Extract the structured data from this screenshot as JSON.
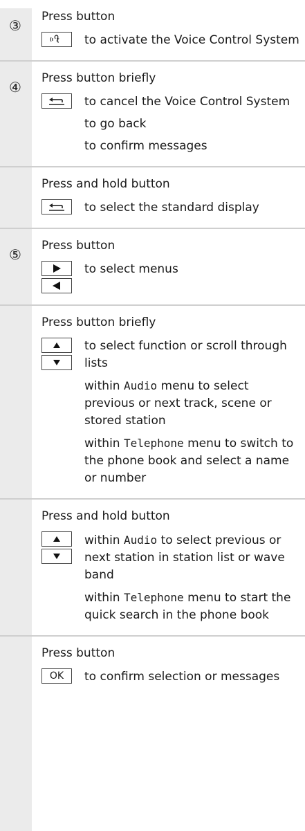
{
  "sections": [
    {
      "number": "③",
      "heading": "Press button",
      "entries": [
        {
          "keys": [
            "voice-icon"
          ],
          "lines": [
            "to activate the Voice Control System"
          ]
        }
      ]
    },
    {
      "number": "④",
      "heading": "Press button briefly",
      "entries": [
        {
          "keys": [
            "back-icon"
          ],
          "lines": [
            "to cancel the Voice Control System",
            "to go back",
            "to confirm messages"
          ]
        }
      ]
    },
    {
      "number": "",
      "heading": "Press and hold button",
      "entries": [
        {
          "keys": [
            "back-icon"
          ],
          "lines": [
            "to select the standard display"
          ]
        }
      ]
    },
    {
      "number": "⑤",
      "heading": "Press button",
      "entries": [
        {
          "keys": [
            "right-arrow-icon",
            "left-arrow-icon"
          ],
          "lines": [
            "to select menus"
          ]
        }
      ]
    },
    {
      "number": "",
      "heading": "Press button briefly",
      "entries": [
        {
          "keys": [
            "up-arrow-icon",
            "down-arrow-icon"
          ],
          "lines": [
            "to select function or scroll through lists",
            {
              "pre": "within ",
              "mono": "Audio",
              "post": " menu to select previous or next track, scene or stored station"
            },
            {
              "pre": "within ",
              "mono": "Telephone",
              "post": " menu to switch to the phone book and select a name or number"
            }
          ]
        }
      ]
    },
    {
      "number": "",
      "heading": "Press and hold button",
      "entries": [
        {
          "keys": [
            "up-arrow-icon",
            "down-arrow-icon"
          ],
          "lines": [
            {
              "pre": "within ",
              "mono": "Audio",
              "post": " to select previous or next station in station list or wave band"
            },
            {
              "pre": "within ",
              "mono": "Telephone",
              "post": " menu to start the quick search in the phone book"
            }
          ]
        }
      ]
    },
    {
      "number": "",
      "heading": "Press button",
      "entries": [
        {
          "keys": [
            "ok-key"
          ],
          "key_label": "OK",
          "lines": [
            "to confirm selection or messages"
          ]
        }
      ]
    }
  ]
}
